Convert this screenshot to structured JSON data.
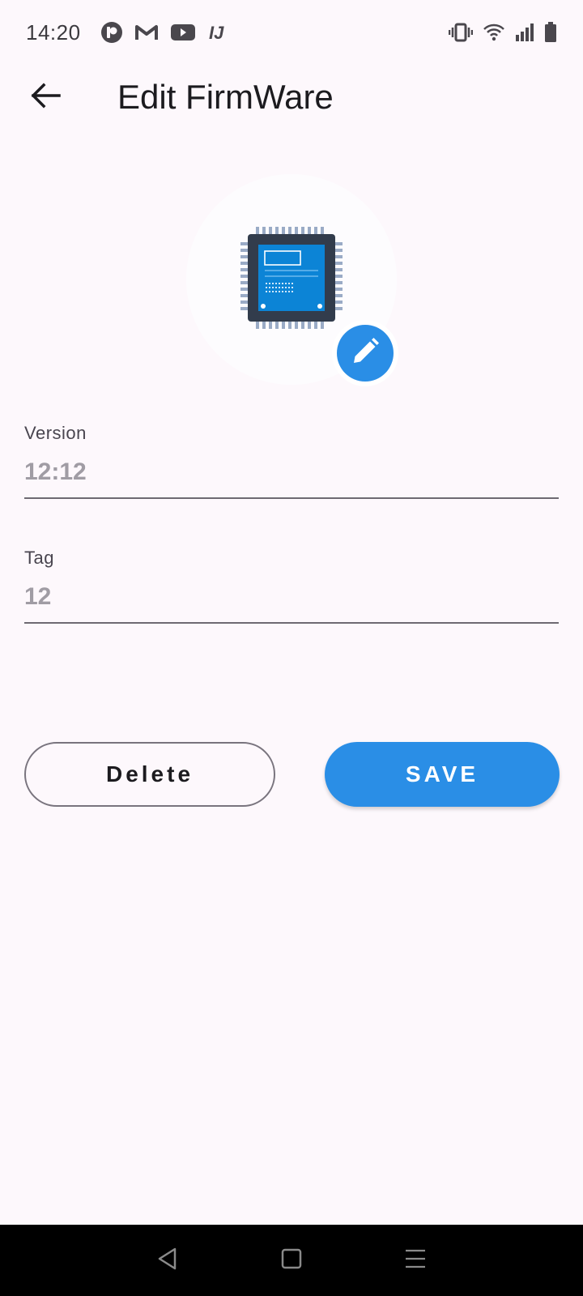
{
  "status_bar": {
    "time": "14:20",
    "left_icons": [
      "notification-p-icon",
      "gmail-icon",
      "youtube-icon",
      "intellij-icon"
    ],
    "right_icons": [
      "vibrate-icon",
      "wifi-icon",
      "signal-icon",
      "battery-icon"
    ]
  },
  "app_bar": {
    "title": "Edit FirmWare",
    "back_icon": "arrow-left-icon"
  },
  "avatar": {
    "image": "chip-icon",
    "edit_icon": "pencil-icon"
  },
  "form": {
    "version": {
      "label": "Version",
      "value": "",
      "placeholder": "12:12"
    },
    "tag": {
      "label": "Tag",
      "value": "",
      "placeholder": "12"
    }
  },
  "actions": {
    "delete_label": "Delete",
    "save_label": "SAVE"
  },
  "nav_bar": {
    "icons": [
      "nav-back-icon",
      "nav-home-icon",
      "nav-menu-icon"
    ]
  },
  "colors": {
    "background": "#fdf8fc",
    "accent": "#2a8ee6",
    "text": "#1c1b1f",
    "hint": "#a09ca4"
  }
}
